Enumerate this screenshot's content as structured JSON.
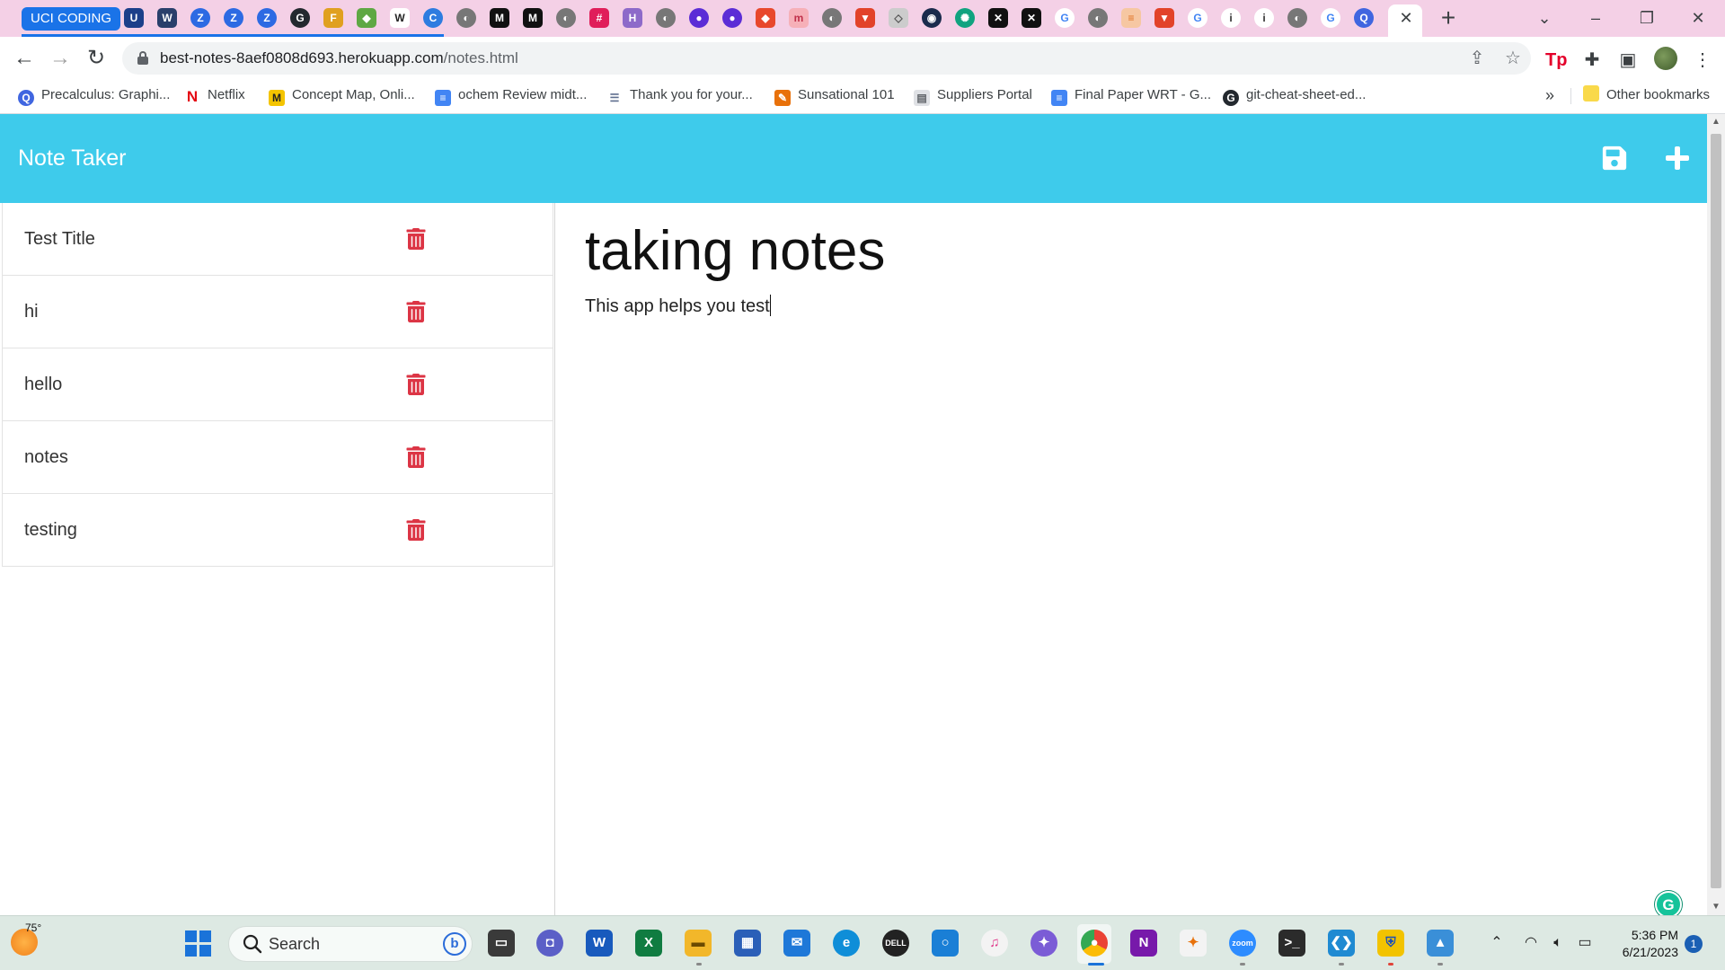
{
  "browser": {
    "tab_group_label": "UCI CODING",
    "url_host": "best-notes-8aef0808d693.herokuapp.com",
    "url_path": "/notes.html",
    "bookmarks": [
      {
        "label": "Precalculus: Graphi...",
        "icon_color": "#4066e0",
        "icon": "search-icon"
      },
      {
        "label": "Netflix",
        "icon_color": "#e50914",
        "icon": "netflix-icon"
      },
      {
        "label": "Concept Map, Onli...",
        "icon_color": "#f4a400",
        "icon": "miro-icon"
      },
      {
        "label": "ochem Review midt...",
        "icon_color": "#4285f4",
        "icon": "docs-icon"
      },
      {
        "label": "Thank you for your...",
        "icon_color": "#5f6f8f",
        "icon": "list-icon"
      },
      {
        "label": "Sunsational 101",
        "icon_color": "#e8710a",
        "icon": "sun-icon"
      },
      {
        "label": "Suppliers Portal",
        "icon_color": "#9aa0a6",
        "icon": "page-icon"
      },
      {
        "label": "Final Paper WRT - G...",
        "icon_color": "#4285f4",
        "icon": "docs-icon"
      },
      {
        "label": "git-cheat-sheet-ed...",
        "icon_color": "#24292f",
        "icon": "github-icon"
      }
    ],
    "more_bookmarks": "»",
    "other_bookmarks": "Other bookmarks"
  },
  "app": {
    "brand": "Note Taker",
    "colors": {
      "navbar": "#3ecbeb",
      "delete": "#dc3545"
    },
    "notes": [
      {
        "title": "Test Title"
      },
      {
        "title": "hi"
      },
      {
        "title": "hello"
      },
      {
        "title": "notes"
      },
      {
        "title": "testing"
      }
    ],
    "active_note": {
      "title": "taking notes",
      "text": "This app helps you test"
    }
  },
  "taskbar": {
    "weather_temp": "75°",
    "search_placeholder": "Search",
    "time": "5:36 PM",
    "date": "6/21/2023",
    "notification_count": "1"
  }
}
